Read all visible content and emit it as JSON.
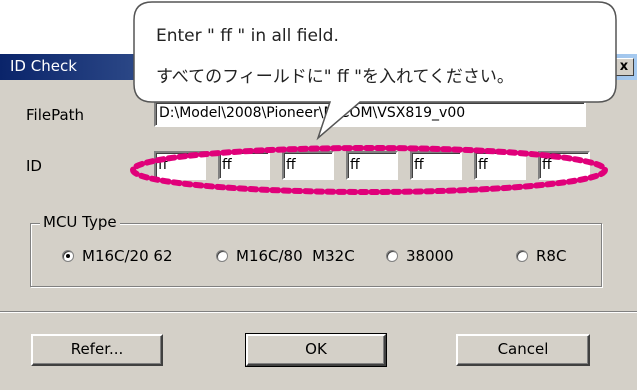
{
  "window": {
    "title": "ID Check",
    "close_glyph": "x"
  },
  "callout": {
    "line1": "Enter \" ff \" in all field.",
    "line2": "すべてのフィールドに\" ff \"を入れてください。",
    "highlight_color": "#e0007a"
  },
  "filepath": {
    "label": "FilePath",
    "value": "D:\\Model\\2008\\Pioneer\\MICOM\\VSX819_v00"
  },
  "id": {
    "label": "ID",
    "fields": [
      "ff",
      "ff",
      "ff",
      "ff",
      "ff",
      "ff",
      "ff"
    ]
  },
  "mcu": {
    "legend": "MCU Type",
    "options": [
      {
        "label": "M16C/20 62",
        "selected": true
      },
      {
        "label": "M16C/80  M32C",
        "selected": false
      },
      {
        "label": "38000",
        "selected": false
      },
      {
        "label": "R8C",
        "selected": false
      }
    ]
  },
  "buttons": {
    "refer": "Refer...",
    "ok": "OK",
    "cancel": "Cancel"
  }
}
